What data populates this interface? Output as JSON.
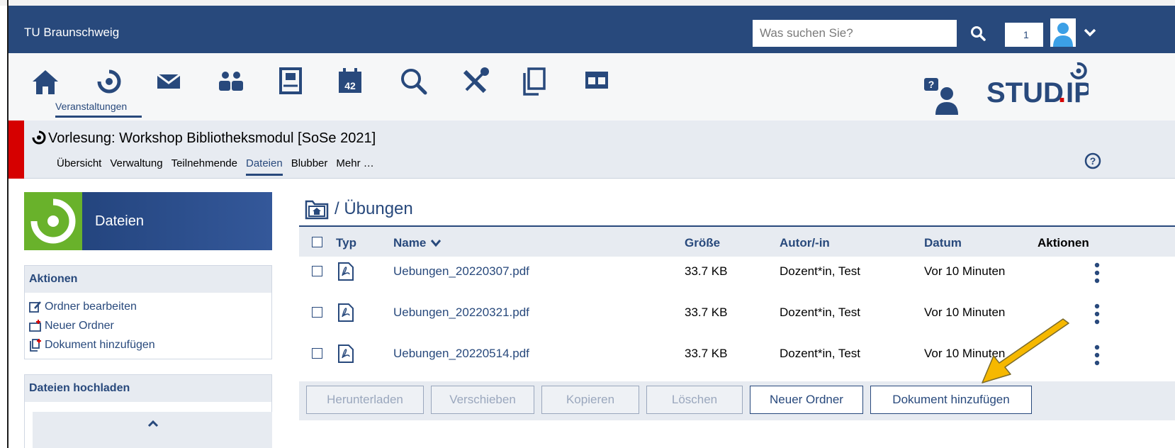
{
  "topbar": {
    "brand": "TU Braunschweig",
    "search_placeholder": "Was suchen Sie?",
    "notification_count": "1"
  },
  "nav": {
    "active_label": "Veranstaltungen",
    "icons": [
      "home-icon",
      "courses-icon",
      "messages-icon",
      "community-icon",
      "profile-icon",
      "calendar-icon",
      "search-icon",
      "tools-icon",
      "files-icon",
      "oer-icon"
    ],
    "calendar_day": "42"
  },
  "logo": {
    "text": "STUD.IP"
  },
  "course": {
    "title": "Vorlesung: Workshop Bibliotheksmodul [SoSe 2021]",
    "tabs": [
      "Übersicht",
      "Verwaltung",
      "Teilnehmende",
      "Dateien",
      "Blubber",
      "Mehr …"
    ],
    "active_tab": "Dateien"
  },
  "sidebar": {
    "title": "Dateien",
    "actions_header": "Aktionen",
    "actions": [
      "Ordner bearbeiten",
      "Neuer Ordner",
      "Dokument hinzufügen"
    ],
    "upload_header": "Dateien hochladen"
  },
  "main": {
    "breadcrumb": "/ Übungen",
    "columns": {
      "type": "Typ",
      "name": "Name",
      "size": "Größe",
      "author": "Autor/-in",
      "date": "Datum",
      "actions": "Aktionen"
    },
    "files": [
      {
        "name": "Uebungen_20220307.pdf",
        "size": "33.7 KB",
        "author": "Dozent*in, Test",
        "date": "Vor 10 Minuten"
      },
      {
        "name": "Uebungen_20220321.pdf",
        "size": "33.7 KB",
        "author": "Dozent*in, Test",
        "date": "Vor 10 Minuten"
      },
      {
        "name": "Uebungen_20220514.pdf",
        "size": "33.7 KB",
        "author": "Dozent*in, Test",
        "date": "Vor 10 Minuten"
      }
    ],
    "buttons": {
      "download": "Herunterladen",
      "move": "Verschieben",
      "copy": "Kopieren",
      "delete": "Löschen",
      "new_folder": "Neuer Ordner",
      "add_document": "Dokument hinzufügen"
    }
  },
  "colors": {
    "primary": "#28497c",
    "accent_red": "#d60000",
    "green": "#69b22b",
    "arrow": "#f6b800"
  }
}
